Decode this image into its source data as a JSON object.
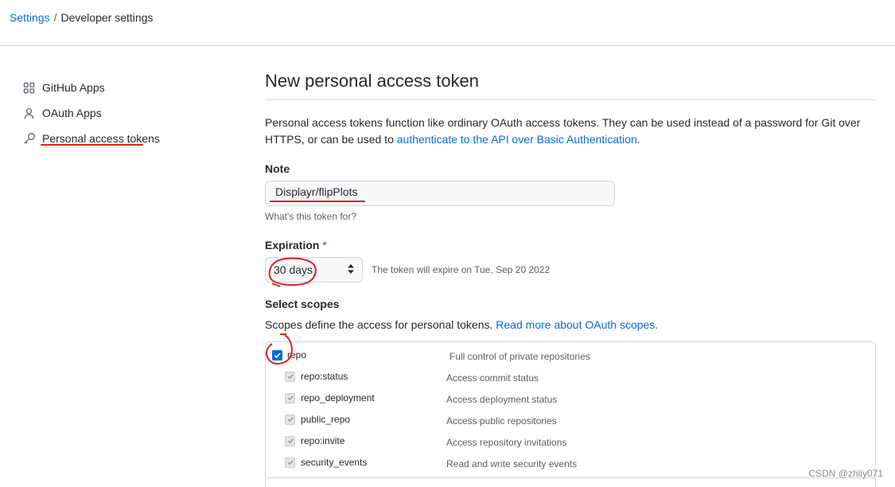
{
  "breadcrumb": {
    "root": "Settings",
    "separator": "/",
    "current": "Developer settings"
  },
  "sidebar": {
    "items": [
      {
        "label": "GitHub Apps",
        "icon": "apps-grid-icon"
      },
      {
        "label": "OAuth Apps",
        "icon": "person-icon"
      },
      {
        "label": "Personal access tokens",
        "icon": "key-icon",
        "selected": true
      }
    ]
  },
  "main": {
    "title": "New personal access token",
    "description_text": "Personal access tokens function like ordinary OAuth access tokens. They can be used instead of a password for Git over HTTPS, or can be used to ",
    "description_link": "authenticate to the API over Basic Authentication",
    "description_end": ".",
    "note": {
      "label": "Note",
      "value": "Displayr/flipPlots",
      "hint": "What's this token for?"
    },
    "expiration": {
      "label": "Expiration",
      "required_mark": "*",
      "selected": "30 days",
      "info": "The token will expire on Tue, Sep 20 2022"
    },
    "scopes": {
      "label": "Select scopes",
      "description": "Scopes define the access for personal tokens.",
      "link": "Read more about OAuth scopes.",
      "items": [
        {
          "name": "repo",
          "description": "Full control of private repositories",
          "checked": true,
          "main": true
        },
        {
          "name": "repo:status",
          "description": "Access commit status",
          "checked": true
        },
        {
          "name": "repo_deployment",
          "description": "Access deployment status",
          "checked": true
        },
        {
          "name": "public_repo",
          "description": "Access public repositories",
          "checked": true
        },
        {
          "name": "repo:invite",
          "description": "Access repository invitations",
          "checked": true
        },
        {
          "name": "security_events",
          "description": "Read and write security events",
          "checked": true
        }
      ]
    }
  },
  "watermark": "CSDN @zhliy071",
  "colors": {
    "link": "#0969da",
    "annotation_red": "#e0201a",
    "checkbox_blue": "#0969da"
  }
}
